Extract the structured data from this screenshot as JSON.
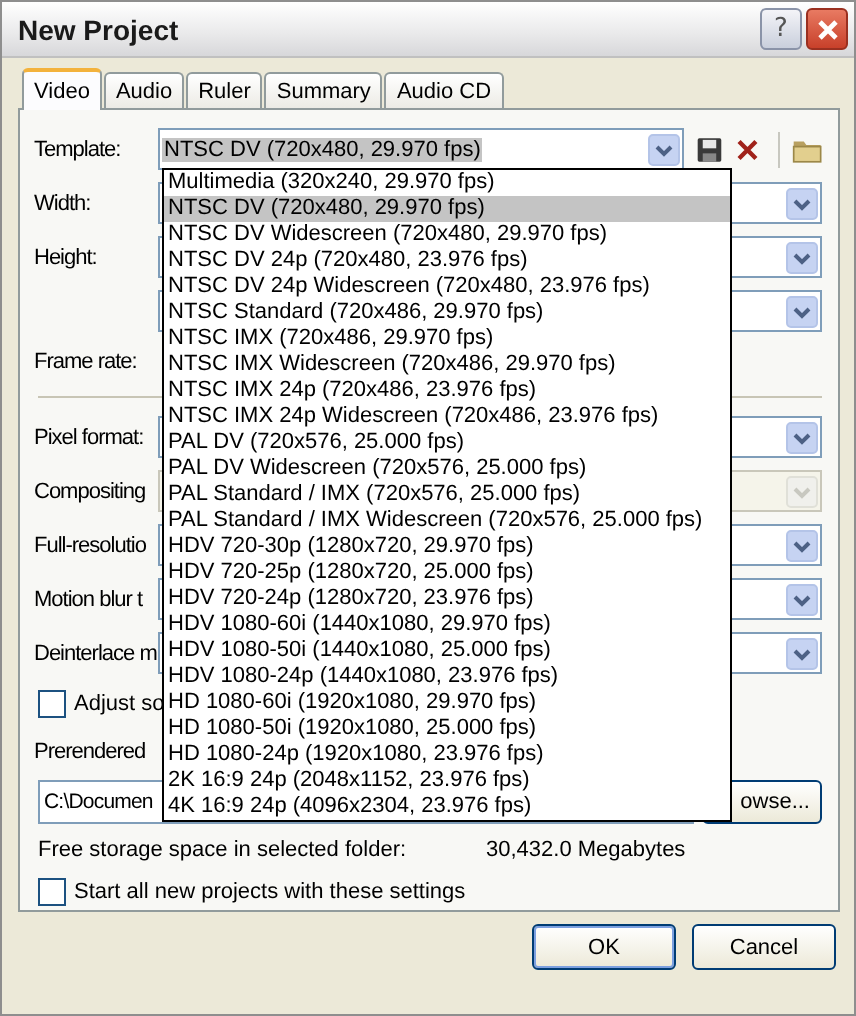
{
  "window": {
    "title": "New Project",
    "help": "?"
  },
  "tabs": [
    {
      "label": "Video",
      "selected": true
    },
    {
      "label": "Audio",
      "selected": false
    },
    {
      "label": "Ruler",
      "selected": false
    },
    {
      "label": "Summary",
      "selected": false
    },
    {
      "label": "Audio CD",
      "selected": false
    }
  ],
  "template": {
    "label": "Template:",
    "value": "NTSC DV (720x480, 29.970 fps)"
  },
  "template_options": [
    {
      "label": "Multimedia (320x240, 29.970 fps)",
      "selected": false
    },
    {
      "label": "NTSC DV (720x480, 29.970 fps)",
      "selected": true
    },
    {
      "label": "NTSC DV Widescreen (720x480, 29.970 fps)",
      "selected": false
    },
    {
      "label": "NTSC DV 24p (720x480, 23.976 fps)",
      "selected": false
    },
    {
      "label": "NTSC DV 24p Widescreen (720x480, 23.976 fps)",
      "selected": false
    },
    {
      "label": "NTSC Standard (720x486, 29.970 fps)",
      "selected": false
    },
    {
      "label": "NTSC IMX (720x486, 29.970 fps)",
      "selected": false
    },
    {
      "label": "NTSC IMX Widescreen (720x486, 29.970 fps)",
      "selected": false
    },
    {
      "label": "NTSC IMX 24p (720x486, 23.976 fps)",
      "selected": false
    },
    {
      "label": "NTSC IMX 24p Widescreen (720x486, 23.976 fps)",
      "selected": false
    },
    {
      "label": "PAL DV (720x576, 25.000 fps)",
      "selected": false
    },
    {
      "label": "PAL DV Widescreen (720x576, 25.000 fps)",
      "selected": false
    },
    {
      "label": "PAL Standard / IMX (720x576, 25.000 fps)",
      "selected": false
    },
    {
      "label": "PAL Standard / IMX Widescreen (720x576, 25.000 fps)",
      "selected": false
    },
    {
      "label": "HDV 720-30p (1280x720, 29.970 fps)",
      "selected": false
    },
    {
      "label": "HDV 720-25p (1280x720, 25.000 fps)",
      "selected": false
    },
    {
      "label": "HDV 720-24p (1280x720, 23.976 fps)",
      "selected": false
    },
    {
      "label": "HDV 1080-60i (1440x1080, 29.970 fps)",
      "selected": false
    },
    {
      "label": "HDV 1080-50i (1440x1080, 25.000 fps)",
      "selected": false
    },
    {
      "label": "HDV 1080-24p (1440x1080, 23.976 fps)",
      "selected": false
    },
    {
      "label": "HD 1080-60i (1920x1080, 29.970 fps)",
      "selected": false
    },
    {
      "label": "HD 1080-50i (1920x1080, 25.000 fps)",
      "selected": false
    },
    {
      "label": "HD 1080-24p (1920x1080, 23.976 fps)",
      "selected": false
    },
    {
      "label": "2K 16:9 24p (2048x1152, 23.976 fps)",
      "selected": false
    },
    {
      "label": "4K 16:9 24p (4096x2304, 23.976 fps)",
      "selected": false
    }
  ],
  "settings": [
    {
      "kind": "combo",
      "label": "Width:",
      "disabled": false
    },
    {
      "kind": "combo",
      "label": "Height:",
      "disabled": false
    },
    {
      "kind": "combo",
      "disabled": false
    },
    {
      "kind": "text",
      "label": "Frame rate:"
    },
    {
      "kind": "separator"
    },
    {
      "kind": "combo",
      "label": "Pixel format:",
      "disabled": false
    },
    {
      "kind": "combo",
      "label": "Compositing",
      "disabled": true
    },
    {
      "kind": "combo",
      "label": "Full-resolutio",
      "disabled": false
    },
    {
      "kind": "combo",
      "label": "Motion blur t",
      "disabled": false
    },
    {
      "kind": "combo",
      "label": "Deinterlace m",
      "disabled": false
    },
    {
      "kind": "checkbox",
      "label": "Adjust so",
      "checked": false
    },
    {
      "kind": "text",
      "label": "Prerendered"
    },
    {
      "kind": "path",
      "value": "C:\\Documen",
      "button": "owse..."
    },
    {
      "kind": "info",
      "label": "Free storage space in selected folder:",
      "value": "30,432.0 Megabytes"
    },
    {
      "kind": "checkbox",
      "label": "Start all new projects with these settings",
      "checked": false
    }
  ],
  "buttons": [
    {
      "label": "OK",
      "default": true
    },
    {
      "label": "Cancel",
      "default": false
    }
  ]
}
